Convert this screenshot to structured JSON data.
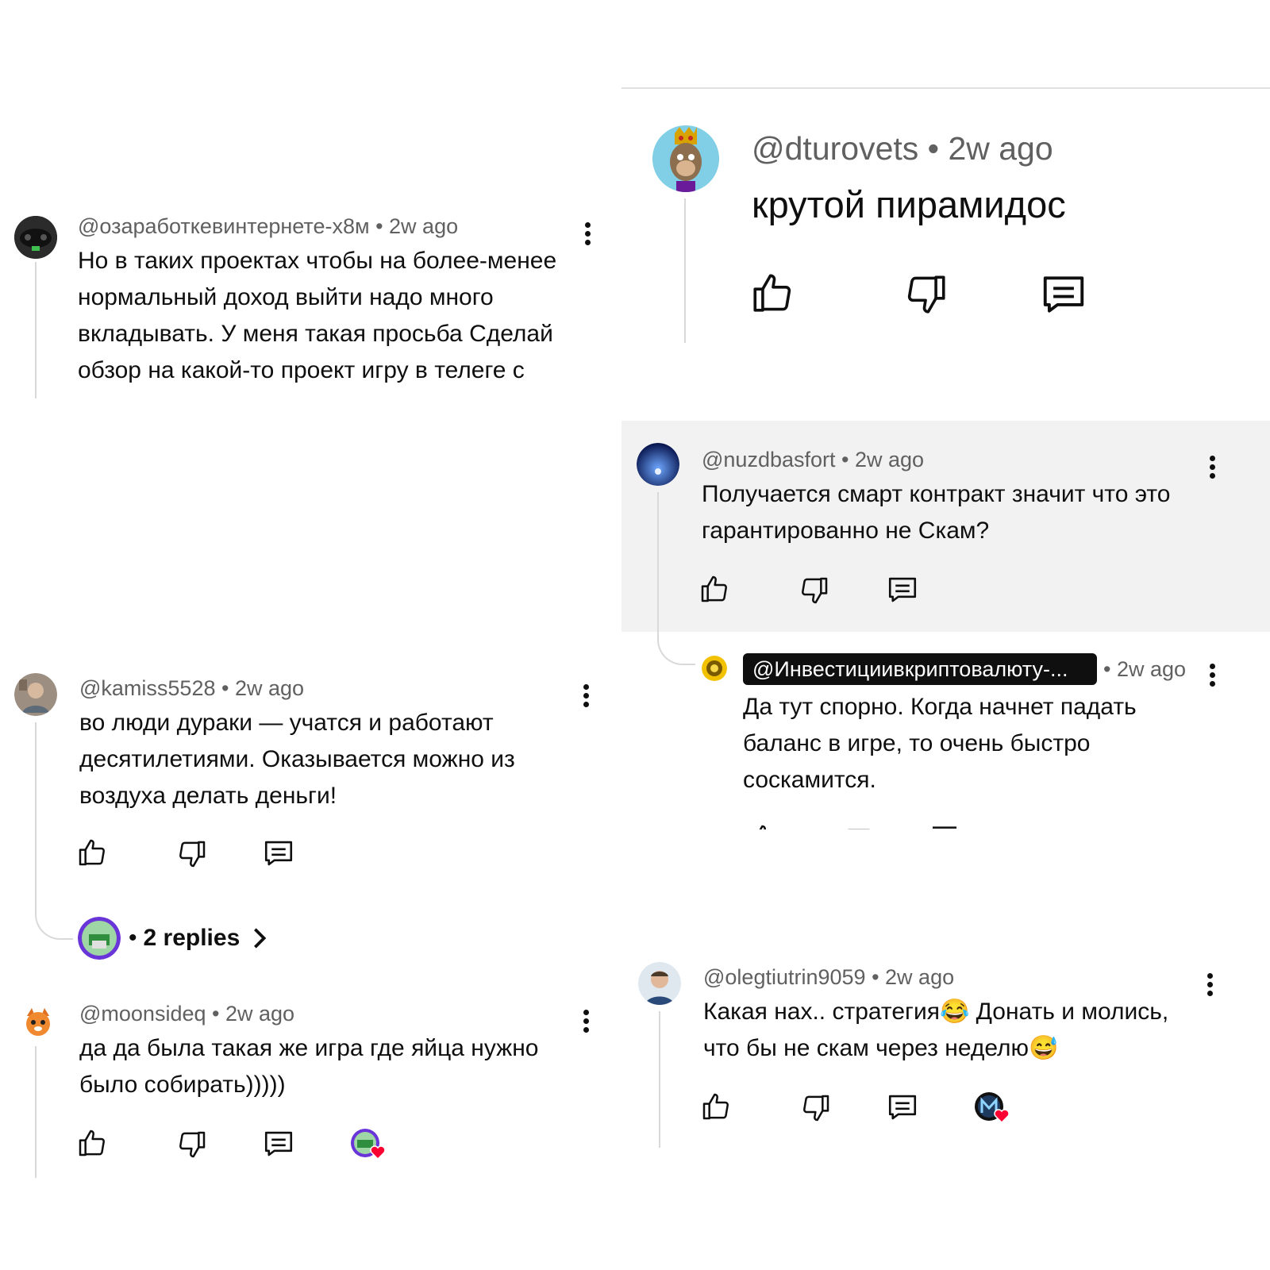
{
  "comments": {
    "c1": {
      "handle": "@озаработкевинтернете-х8м",
      "time": "2w ago",
      "text": "Но в таких проектах чтобы на более-менее нормальный доход выйти надо много вкладывать. У меня такая просьба Сделай обзор на какой-то проект игру в телеге с"
    },
    "c2": {
      "handle": "@dturovets",
      "time": "2w ago",
      "text": "крутой пирамидос"
    },
    "c3": {
      "handle": "@nuzdbasfort",
      "time": "2w ago",
      "text": "Получается смарт контракт значит что это гарантированно не Скам?"
    },
    "c3_reply": {
      "handle": "@Инвестициивкриптовалюту-...",
      "time": "2w ago",
      "text": "Да тут спорно. Когда начнет падать баланс в игре, то очень быстро соскамится."
    },
    "c4": {
      "handle": "@kamiss5528",
      "time": "2w ago",
      "text": "во люди дураки — учатся и работают десятилетиями. Оказывается можно из воздуха делать деньги!",
      "replies_label": "2 replies"
    },
    "c5": {
      "handle": "@moonsideq",
      "time": "2w ago",
      "text": "да да была такая же игра где яйца нужно было собирать)))))"
    },
    "c6": {
      "handle": "@olegtiutrin9059",
      "time": "2w ago",
      "text": "Какая нах.. стратегия😂 Донать и молись, что бы не скам через неделю😅"
    }
  },
  "separator": "•",
  "icons": [
    "like-icon",
    "dislike-icon",
    "reply-icon",
    "more-options-icon",
    "chevron-right-icon",
    "heart-icon"
  ],
  "colors": {
    "text": "#0f0f0f",
    "meta": "#606060",
    "panel": "#f2f2f2",
    "heart": "#ff0033",
    "line": "#d9d9d9"
  }
}
